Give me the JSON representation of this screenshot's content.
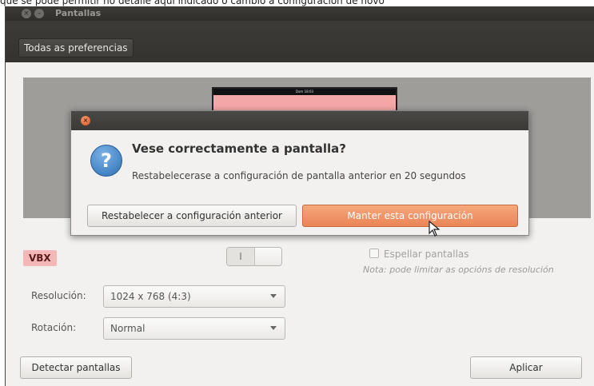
{
  "top_caption": "que se pode permitir no detalle aquí indicado o cambio á configuración de novo",
  "window": {
    "title": "Pantallas",
    "toolbar": {
      "all_preferences": "Todas as preferencias"
    }
  },
  "preview": {
    "monitor_bar_text": "Dom 18:03"
  },
  "display": {
    "name_label": "VBX",
    "toggle_label": "I",
    "mirror_label": "Espellar pantallas",
    "note": "Nota: pode limitar as opcións de resolución",
    "resolution_label": "Resolución:",
    "resolution_value": "1024 x 768 (4:3)",
    "rotation_label": "Rotación:",
    "rotation_value": "Normal",
    "detect_button": "Detectar pantallas",
    "apply_button": "Aplicar"
  },
  "dialog": {
    "title": "Vese correctamente a pantalla?",
    "message": "Restabelecerase a configuración de pantalla anterior en 20 segundos",
    "revert_button": "Restabelecer a configuración anterior",
    "keep_button": "Manter esta configuración",
    "question_glyph": "?",
    "close_glyph": "×",
    "accent_color": "#ea8557"
  }
}
